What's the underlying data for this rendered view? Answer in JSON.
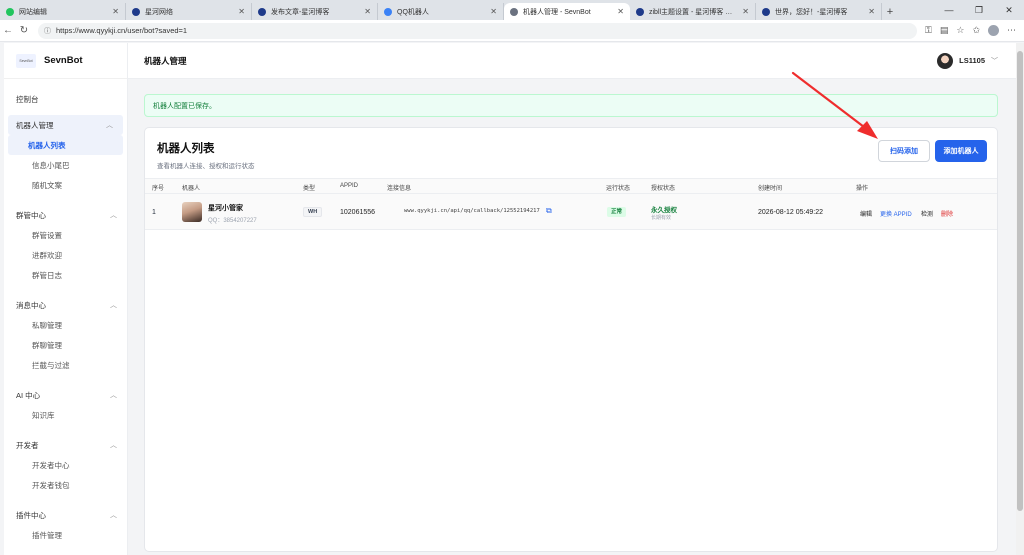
{
  "browser": {
    "tabs": [
      {
        "label": "网站编辑",
        "fav": "#22c55e"
      },
      {
        "label": "星河网络",
        "fav": "#1e3a8a"
      },
      {
        "label": "发布文章-星河博客",
        "fav": "#1e3a8a"
      },
      {
        "label": "QQ机器人",
        "fav": "#3b82f6"
      },
      {
        "label": "机器人管理 - SevnBot",
        "fav": "#6b7280"
      },
      {
        "label": "zibll主题设置 - 星河博客 — WordPr...",
        "fav": "#1e3a8a"
      },
      {
        "label": "世界，您好！-星河博客",
        "fav": "#1e3a8a"
      }
    ],
    "url": "https://www.qyykji.cn/user/bot?saved=1"
  },
  "sidebar": {
    "brand": "SevnBot",
    "logo_text": "SevnBot",
    "dashboard": "控制台",
    "groups": [
      {
        "label": "机器人管理",
        "items": [
          "机器人列表",
          "信息小尾巴",
          "随机文案"
        ]
      },
      {
        "label": "群管中心",
        "items": [
          "群管设置",
          "进群欢迎",
          "群管日志"
        ]
      },
      {
        "label": "消息中心",
        "items": [
          "私聊管理",
          "群聊管理",
          "拦截与过滤"
        ]
      },
      {
        "label": "AI 中心",
        "items": [
          "知识库"
        ]
      },
      {
        "label": "开发者",
        "items": [
          "开发者中心",
          "开发者钱包"
        ]
      },
      {
        "label": "插件中心",
        "items": [
          "插件管理"
        ]
      }
    ]
  },
  "header": {
    "title": "机器人管理",
    "username": "LS1105"
  },
  "notice": "机器人配置已保存。",
  "panel": {
    "title": "机器人列表",
    "subtitle": "查看机器人连接、授权和运行状态",
    "scan_button": "扫码添加",
    "add_button": "添加机器人",
    "columns": [
      "序号",
      "机器人",
      "类型",
      "APPID",
      "连接信息",
      "运行状态",
      "授权状态",
      "创建时间",
      "操作"
    ],
    "rows": [
      {
        "index": "1",
        "name": "星河小管家",
        "qq": "QQ：3854207227",
        "type": "WH",
        "appid": "102061556",
        "connection": "www.qyykji.cn/api/qq/callback/12552194217",
        "run_status": "正常",
        "auth_status": "永久授权",
        "auth_note": "长期有效",
        "created": "2026-08-12 05:49:22",
        "actions": {
          "edit": "编辑",
          "change": "更换 APPID",
          "check": "检测",
          "delete": "删除"
        }
      }
    ]
  },
  "colors": {
    "accent": "#2563eb",
    "success": "#15803d",
    "danger": "#dc2626",
    "annotation": "#ef2d2d"
  }
}
